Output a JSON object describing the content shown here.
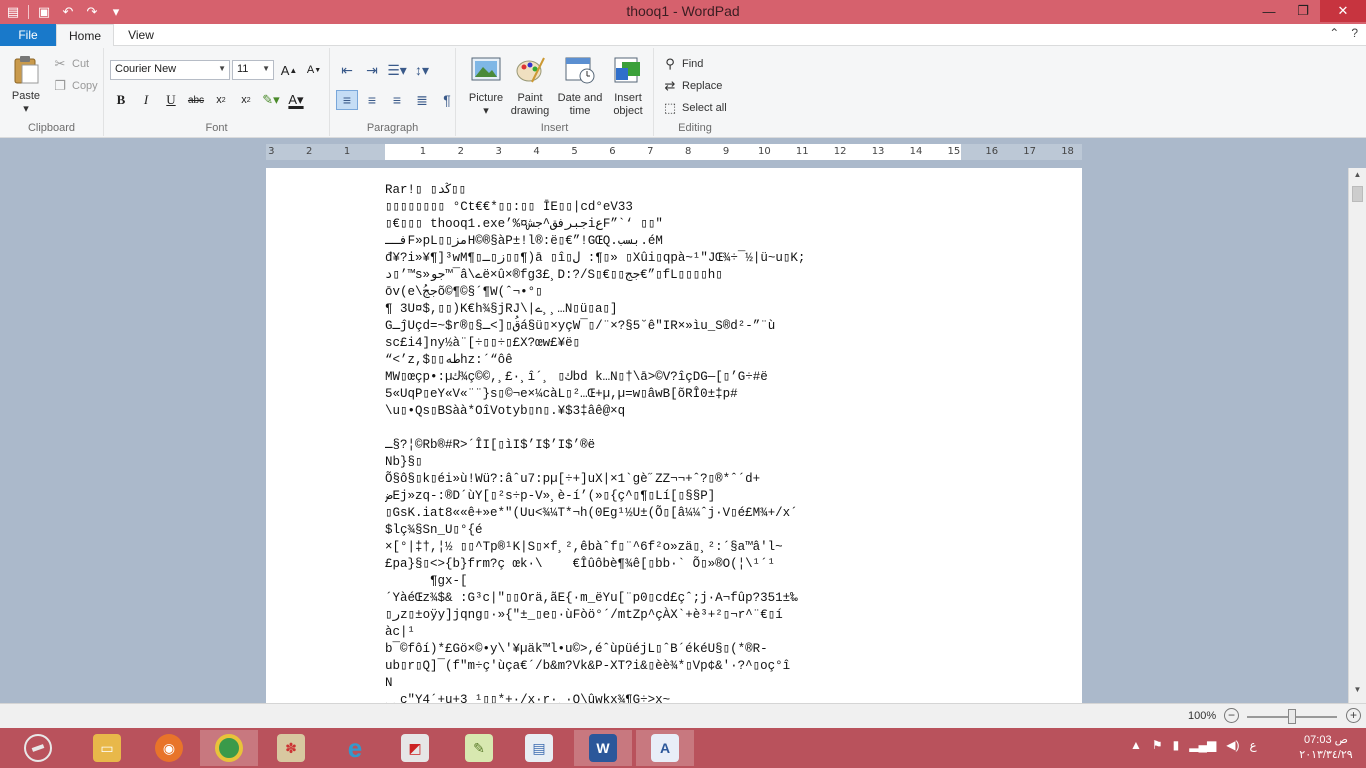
{
  "window": {
    "title": "thooq1 - WordPad"
  },
  "qat": {
    "icons": [
      "wordpad-icon",
      "save-icon",
      "undo-icon",
      "redo-icon",
      "customize-icon"
    ]
  },
  "tabs": {
    "file": "File",
    "home": "Home",
    "view": "View"
  },
  "clipboard": {
    "paste": "Paste",
    "cut": "Cut",
    "copy": "Copy",
    "label": "Clipboard"
  },
  "font": {
    "family": "Courier New",
    "size": "11",
    "label": "Font"
  },
  "paragraph": {
    "label": "Paragraph"
  },
  "insert": {
    "picture": "Picture",
    "paint_line1": "Paint",
    "paint_line2": "drawing",
    "datetime_line1": "Date and",
    "datetime_line2": "time",
    "object_line1": "Insert",
    "object_line2": "object",
    "label": "Insert"
  },
  "editing": {
    "find": "Find",
    "replace": "Replace",
    "select_all": "Select all",
    "label": "Editing"
  },
  "ruler": {
    "ticks": [
      "3",
      "2",
      "1",
      "1",
      "2",
      "3",
      "4",
      "5",
      "6",
      "7",
      "8",
      "9",
      "10",
      "11",
      "12",
      "13",
      "14",
      "15",
      "16",
      "17",
      "18"
    ]
  },
  "document": {
    "lines": [
      "Rar!▯ ▯ڭد▯▯",
      "▯▯▯▯▯▯▯▯ °Ct€€*▯▯:▯▯ ĪE▯▯|cd°eV33",
      "▯€▯▯▯ thooq1.exe’%¤جبرفق^جشiعF”`‘ ▯▯\"",
      "فــF»pL▯▯مزH©®§àP±!l®:ë▯€”!GŒQ.بسب.éM",
      "đ¥?i»¥¶]³wM¶▯ز▯ـ▯▯¶)ā ▯î▯ل :¶▯» ▯Xûi▯qpà~¹\"JŒ¾÷¯½|ü~u▯K;",
      "د▯’™s»جو™¯â\\ےë×û×®fg3£¸D:?/S▯€▯▯جج€”▯fL▯▯▯▯h▯",
      "ōv(e\\ججُõ©¶©§´¶W(ˆ¬•°▯",
      "¶ 3U¤$,▯▯)K€h¾§jRJ\\|ے¸¸…N▯ü▯a▯]",
      "GـĵUçd=~$r®▯§قُ▯[>ـá§ü▯×yçW¯▯/¨×?§5˘ê\"IR×»ìu_S®d²-”¨ù",
      "sc£i4]ny½à¨[÷▯▯÷▯£X?œw£¥ë▯",
      "“<’z,$▯▯طهhz:´“ôê",
      "MW▯œçp•:µك¾ç©©,¸£·¸î´¸ ▯كbd k…N▯†\\ā>©V?îçDG—[▯’G÷#ë",
      "5«UqP▯eY«V«¨¨}s▯©¬e×¼càL▯²…Œ+µ,µ=w▯âwB[õRÎ0±‡p#",
      "\\u▯•Qs▯BSàà*OîVotyb▯n▯.¥$3‡âê@×q",
      "",
      "ـ§?¦©Rb®#R>´ÎI[▯ìI$’I$’I$’®ë",
      "Nb}§▯",
      "Õ§ô§▯k▯éi»ù!Wü?:âˆu7:pµ[÷+]uX|×1`gè˝ZZ¬¬+ˆ?▯®*ˆ´d+",
      "ضEj»zq-:®D´ùY[▯²s÷p-V»¸è-í’(»▯{ç^▯¶▯Lí[▯§§P]",
      "▯GsK.iat8««ê+»e*\"(Uu<¾¼T*¬h(0Eg¹½U±(Õ▯[â¼¼ˆj·V▯é£M¾+/x´",
      "$lç¾§Sn_U▯°{é",
      "×[°|‡†,¦½ ▯▯^Tp®¹K|S▯×f¸²,êbàˆf▯¨^6f²o»zä▯¸²:´§a™â'l~",
      "£pa}§▯<>{b}frm?ç œk·\\    €Îûôbè¶¾ê[▯bb·` Õ▯»®O(¦\\¹´¹",
      "      ¶gx-[",
      "´YàéŒz¾$& :G³c|\"▯▯Orä,ãE{·m_ëYu[¨p0▯cd£çˆ;j·A¬fûp?351±‰",
      "▯رz▯±oÿy]jqng▯·»{\"±_▯e▯·ùFòö°´/mtZp^çÀX`+è³+²▯¬r^¨€▯í",
      "àc|¹",
      "b¯©fôí)*£Gö×©•y\\'¥µäk™l•u©>,éˆùpüéjL▯ˆB´ékéU§▯(*®R-",
      "ub▯r▯Q]¯(f\"m÷ç'ùça€´/b&m?Vk&P-XT?i&▯èè¾*▯Vp¢&'·?^▯oç°î",
      "N",
      "¸¸ç\"Y4´+u+3 ¹▯▯*+·/x·r·¸·Q\\ûwkx¾¶G÷>x~"
    ]
  },
  "status": {
    "zoom": "100%",
    "zoom_value_pct": 100
  },
  "taskbar": {
    "apps": [
      "file-explorer-icon",
      "firefox-icon",
      "chrome-icon",
      "paint-icon",
      "internet-explorer-icon",
      "photo-app-icon",
      "notepad-icon",
      "wordpad-alt-icon",
      "word-icon",
      "wordpad-icon"
    ],
    "tray_lang": "ع",
    "time": "07:03 ص",
    "date": "٢٠١٣/٣٤/٢٩"
  }
}
